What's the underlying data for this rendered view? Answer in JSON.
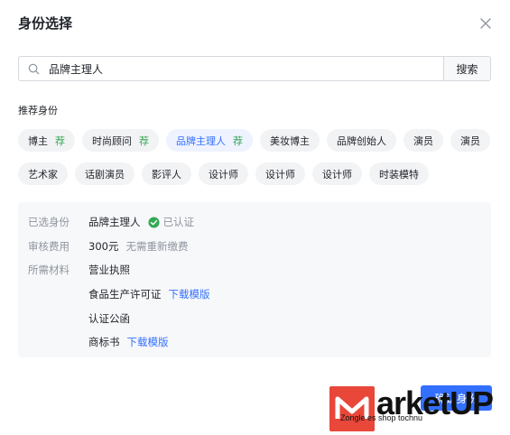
{
  "dialog": {
    "title": "身份选择",
    "close_icon": "close-icon"
  },
  "search": {
    "value": "品牌主理人",
    "placeholder": "",
    "button_label": "搜索",
    "icon": "search-icon"
  },
  "recommend": {
    "label": "推荐身份",
    "tags": [
      {
        "label": "博主",
        "badge": "荐",
        "active": false
      },
      {
        "label": "时尚顾问",
        "badge": "荐",
        "active": false
      },
      {
        "label": "品牌主理人",
        "badge": "荐",
        "active": true
      },
      {
        "label": "美妆博主",
        "badge": "",
        "active": false
      },
      {
        "label": "品牌创始人",
        "badge": "",
        "active": false
      },
      {
        "label": "演员",
        "badge": "",
        "active": false
      },
      {
        "label": "演员",
        "badge": "",
        "active": false
      },
      {
        "label": "艺术家",
        "badge": "",
        "active": false
      },
      {
        "label": "话剧演员",
        "badge": "",
        "active": false
      },
      {
        "label": "影评人",
        "badge": "",
        "active": false
      },
      {
        "label": "设计师",
        "badge": "",
        "active": false
      },
      {
        "label": "设计师",
        "badge": "",
        "active": false
      },
      {
        "label": "设计师",
        "badge": "",
        "active": false
      },
      {
        "label": "时装模特",
        "badge": "",
        "active": false
      }
    ]
  },
  "info": {
    "selected_key": "已选身份",
    "selected_value": "品牌主理人",
    "verified_label": "已认证",
    "fee_key": "审核费用",
    "fee_value": "300元",
    "fee_note": "无需重新缴费",
    "materials_key": "所需材料",
    "materials": [
      {
        "label": "营业执照",
        "link": ""
      },
      {
        "label": "食品生产许可证",
        "link": "下载模版"
      },
      {
        "label": "认证公函",
        "link": ""
      },
      {
        "label": "商标书",
        "link": "下载模版"
      }
    ]
  },
  "footer": {
    "confirm_label": "确认身份"
  },
  "watermark": {
    "brand": "arketUP",
    "sub": "Zongle es shop tochnu"
  },
  "colors": {
    "accent": "#3370ff",
    "badge": "#34a853",
    "verified": "#34a853",
    "watermark": "#e8473a"
  }
}
